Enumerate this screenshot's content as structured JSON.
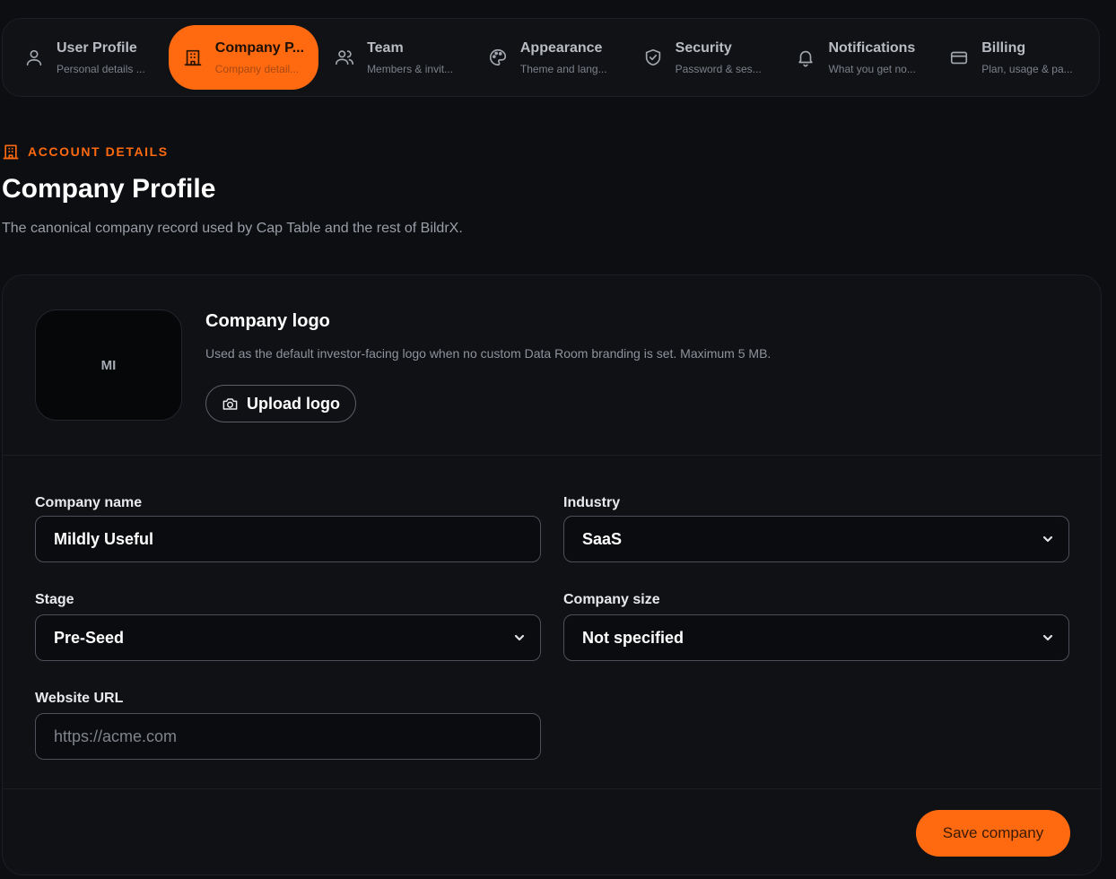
{
  "tabs": [
    {
      "label": "User Profile",
      "sub": "Personal details ...",
      "icon": "user-icon",
      "active": false
    },
    {
      "label": "Company P...",
      "sub": "Company detail...",
      "icon": "building-icon",
      "active": true
    },
    {
      "label": "Team",
      "sub": "Members & invit...",
      "icon": "users-icon",
      "active": false
    },
    {
      "label": "Appearance",
      "sub": "Theme and lang...",
      "icon": "palette-icon",
      "active": false
    },
    {
      "label": "Security",
      "sub": "Password & ses...",
      "icon": "shield-icon",
      "active": false
    },
    {
      "label": "Notifications",
      "sub": "What you get no...",
      "icon": "bell-icon",
      "active": false
    },
    {
      "label": "Billing",
      "sub": "Plan, usage & pa...",
      "icon": "credit-card-icon",
      "active": false
    }
  ],
  "header": {
    "eyebrow": "ACCOUNT DETAILS",
    "title": "Company Profile",
    "description": "The canonical company record used by Cap Table and the rest of BildrX."
  },
  "logo": {
    "initials": "MI",
    "title": "Company logo",
    "description": "Used as the default investor-facing logo when no custom Data Room branding is set. Maximum 5 MB.",
    "upload_label": "Upload logo"
  },
  "form": {
    "company_name": {
      "label": "Company name",
      "value": "Mildly Useful"
    },
    "industry": {
      "label": "Industry",
      "value": "SaaS"
    },
    "stage": {
      "label": "Stage",
      "value": "Pre-Seed"
    },
    "company_size": {
      "label": "Company size",
      "value": "Not specified"
    },
    "website": {
      "label": "Website URL",
      "value": "",
      "placeholder": "https://acme.com"
    }
  },
  "actions": {
    "save_label": "Save company"
  },
  "colors": {
    "accent": "#ff6a10",
    "background": "#0c0e12",
    "card": "#0f1115"
  }
}
